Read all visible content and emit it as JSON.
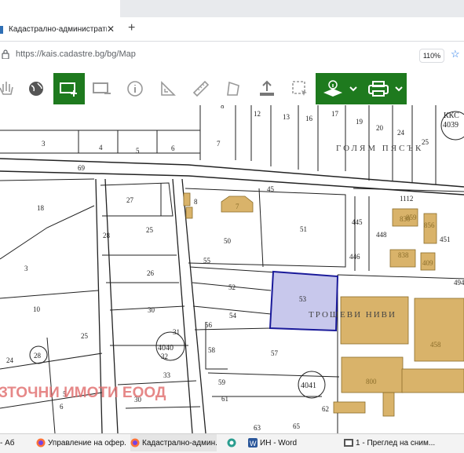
{
  "browser": {
    "tab_title": "Кадастрално-административн",
    "tab_close": "✕",
    "new_tab": "+",
    "url": "https://kais.cadastre.bg/bg/Map",
    "zoom": "110%"
  },
  "toolbar": {
    "icons": [
      "pan-icon",
      "globe-icon",
      "select-rect-icon",
      "select-area-icon",
      "info-icon",
      "ruler-area-icon",
      "ruler-icon",
      "polygon-icon",
      "upload-icon",
      "select-dashed-icon",
      "layers-info-icon",
      "printer-icon"
    ]
  },
  "map": {
    "watermark": "ЗТОЧНИ ИМОТИ ЕООД",
    "area_labels": [
      "ГОЛЯМ ПЯСЪК",
      "ТРОШЕВИ НИВИ",
      "ККС"
    ],
    "parcels": [
      "3",
      "4",
      "5",
      "6",
      "7",
      "8",
      "12",
      "13",
      "16",
      "17",
      "19",
      "20",
      "24",
      "25",
      "4039",
      "69",
      "18",
      "27",
      "25",
      "28",
      "3",
      "10",
      "24",
      "28",
      "25",
      "6",
      "5",
      "26",
      "30",
      "31",
      "32",
      "4040",
      "33",
      "30",
      "59",
      "61",
      "63",
      "65",
      "8",
      "50",
      "51",
      "55",
      "52",
      "54",
      "56",
      "53",
      "57",
      "58",
      "4041",
      "62",
      "445",
      "446",
      "448",
      "451",
      "1112",
      "494",
      "458",
      "800",
      "45",
      "7",
      "830",
      "838",
      "856",
      "859",
      "409"
    ]
  },
  "taskbar": {
    "items": [
      "- Аб",
      "Управление на офер...",
      "Кадастрално-админ...",
      "ИН - Word",
      "1 - Преглед на сним..."
    ]
  }
}
